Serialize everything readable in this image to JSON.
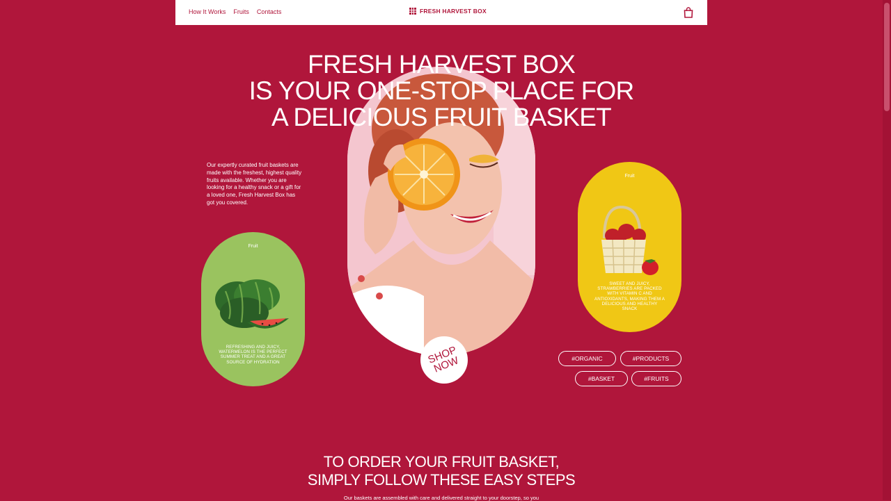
{
  "nav": {
    "links": [
      "How It Works",
      "Fruits",
      "Contacts"
    ],
    "brand": "FRESH HARVEST BOX",
    "brand_icon": "grid-icon",
    "cart_icon": "shopping-bag-icon"
  },
  "hero": {
    "headline": [
      "FRESH HARVEST BOX",
      "IS YOUR ONE-STOP PLACE FOR",
      "A DELICIOUS FRUIT BASKET"
    ],
    "intro": "Our expertly curated fruit baskets are made with the freshest, highest quality fruits available. Whether you are looking for a healthy snack or a gift for a loved one, Fresh Harvest Box has got you covered.",
    "shop_now": [
      "SHOP",
      "NOW"
    ]
  },
  "cards": [
    {
      "tag": "Fruit",
      "desc": "Refreshing and juicy, watermelon is the perfect summer treat and a great source of hydration",
      "color": "#9ac35f"
    },
    {
      "tag": "Fruit",
      "desc": "Sweet and juicy, strawberries are packed with vitamin C and antioxidants, making them a delicious and healthy snack",
      "color": "#f0c715"
    }
  ],
  "tags": [
    "#ORGANIC",
    "#PRODUCTS",
    "#BASKET",
    "#FRUITS"
  ],
  "steps": {
    "title": [
      "TO ORDER YOUR FRUIT BASKET,",
      "SIMPLY FOLLOW THESE EASY STEPS"
    ],
    "subtitle": "Our baskets are assembled with care and delivered straight to your doorstep, so you"
  },
  "colors": {
    "background": "#b0163b",
    "nav": "#ffffff",
    "green": "#9ac35f",
    "yellow": "#f0c715"
  }
}
